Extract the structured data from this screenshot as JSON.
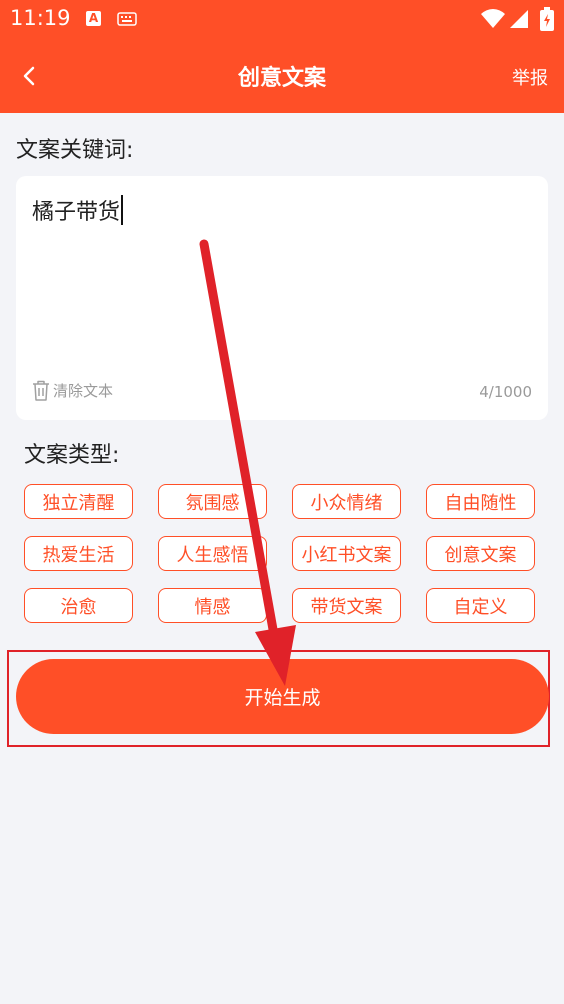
{
  "status_bar": {
    "time": "11:19",
    "icons": [
      "a-notification-icon",
      "keyboard-icon",
      "wifi-icon",
      "signal-icon",
      "battery-icon"
    ]
  },
  "header": {
    "title": "创意文案",
    "report_label": "举报",
    "back_icon": "chevron-left-icon"
  },
  "keyword_section": {
    "label": "文案关键词:",
    "input_value": "橘子带货",
    "clear_label": "清除文本",
    "counter": "4/1000"
  },
  "type_section": {
    "label": "文案类型:",
    "tags": [
      "独立清醒",
      "氛围感",
      "小众情绪",
      "自由随性",
      "热爱生活",
      "人生感悟",
      "小红书文案",
      "创意文案",
      "治愈",
      "情感",
      "带货文案",
      "自定义"
    ]
  },
  "generate_button": {
    "label": "开始生成"
  },
  "colors": {
    "brand": "#ff4f27",
    "annotation": "#e02229",
    "background": "#f3f4f8"
  }
}
